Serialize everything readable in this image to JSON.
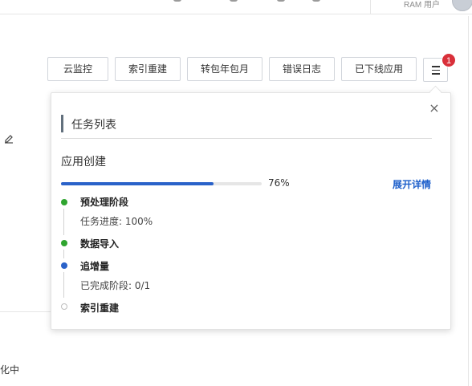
{
  "header": {
    "user_label": "RAM 用户"
  },
  "toolbar": {
    "buttons": [
      {
        "label": "云监控"
      },
      {
        "label": "索引重建"
      },
      {
        "label": "转包年包月"
      },
      {
        "label": "错误日志"
      },
      {
        "label": "已下线应用"
      }
    ],
    "menu_icon": "hamburger-icon",
    "badge_count": "1"
  },
  "popover": {
    "title": "任务列表",
    "task_name": "应用创建",
    "progress_percent": 76,
    "progress_label": "76%",
    "expand_label": "展开详情",
    "steps": [
      {
        "label": "预处理阶段",
        "detail": "任务进度: 100%",
        "status": "done"
      },
      {
        "label": "数据导入",
        "detail": "",
        "status": "done"
      },
      {
        "label": "追增量",
        "detail": "已完成阶段: 0/1",
        "status": "active"
      },
      {
        "label": "索引重建",
        "detail": "",
        "status": "pending"
      }
    ]
  },
  "page": {
    "status_text": "化中"
  },
  "colors": {
    "accent": "#2a62c9",
    "done": "#2fa52f",
    "badge": "#d9303a",
    "link": "#1d5fcb"
  }
}
